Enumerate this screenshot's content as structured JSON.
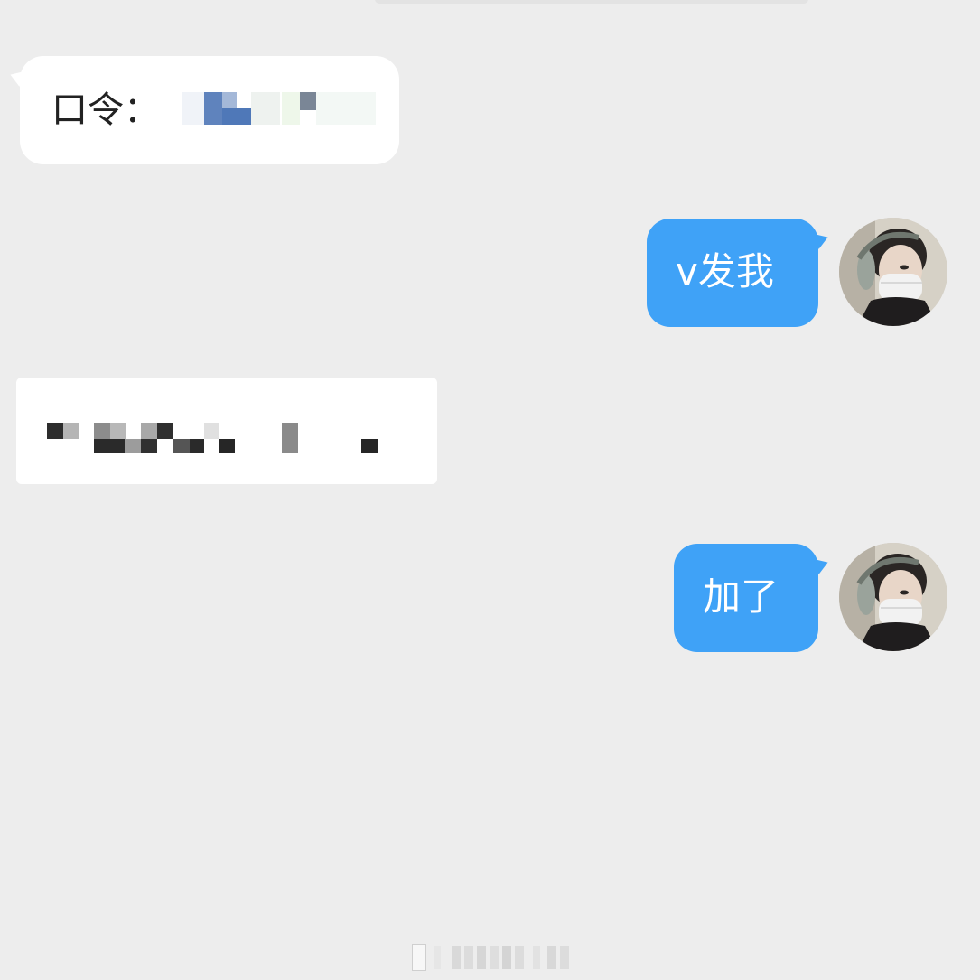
{
  "messages": [
    {
      "side": "left",
      "text": "口令：",
      "censored": true
    },
    {
      "side": "right",
      "text": "v发我",
      "avatar": "user-avatar"
    },
    {
      "side": "left",
      "text": "",
      "censored": true
    },
    {
      "side": "right",
      "text": "加了",
      "avatar": "user-avatar"
    }
  ],
  "colors": {
    "background": "#ededed",
    "incoming_bubble": "#ffffff",
    "outgoing_bubble": "#3fa2f7",
    "outgoing_text": "#ffffff",
    "incoming_text": "#222222"
  }
}
